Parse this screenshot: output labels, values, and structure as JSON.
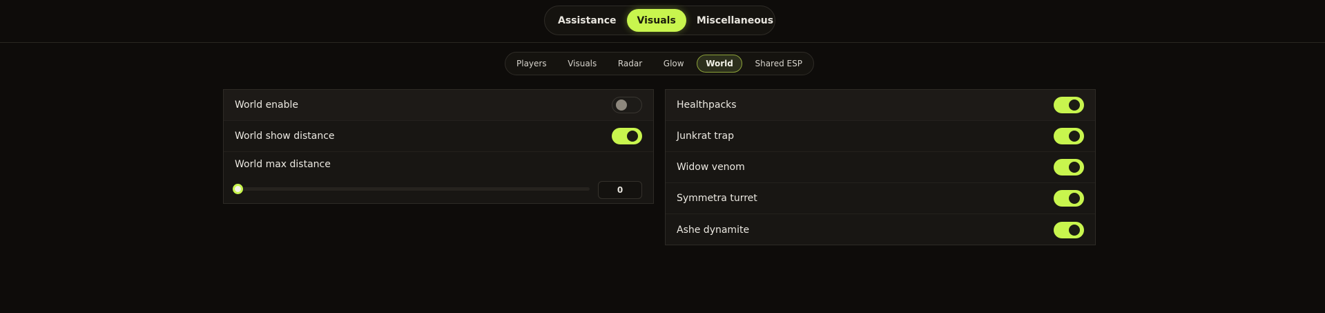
{
  "main_tabs": [
    {
      "label": "Assistance",
      "active": false
    },
    {
      "label": "Visuals",
      "active": true
    },
    {
      "label": "Miscellaneous",
      "active": false
    }
  ],
  "sub_tabs": [
    {
      "label": "Players",
      "active": false
    },
    {
      "label": "Visuals",
      "active": false
    },
    {
      "label": "Radar",
      "active": false
    },
    {
      "label": "Glow",
      "active": false
    },
    {
      "label": "World",
      "active": true
    },
    {
      "label": "Shared ESP",
      "active": false
    }
  ],
  "left_panel": {
    "world_enable": {
      "label": "World enable",
      "on": false
    },
    "world_show_distance": {
      "label": "World show distance",
      "on": true
    },
    "world_max_distance": {
      "label": "World max distance",
      "value": "0",
      "fraction": 0
    }
  },
  "right_panel": {
    "items": [
      {
        "label": "Healthpacks",
        "on": true
      },
      {
        "label": "Junkrat trap",
        "on": true
      },
      {
        "label": "Widow venom",
        "on": true
      },
      {
        "label": "Symmetra turret",
        "on": true
      },
      {
        "label": "Ashe dynamite",
        "on": true
      }
    ]
  },
  "colors": {
    "accent": "#c8f54e",
    "background": "#0e0c0a",
    "panel": "#181613"
  }
}
